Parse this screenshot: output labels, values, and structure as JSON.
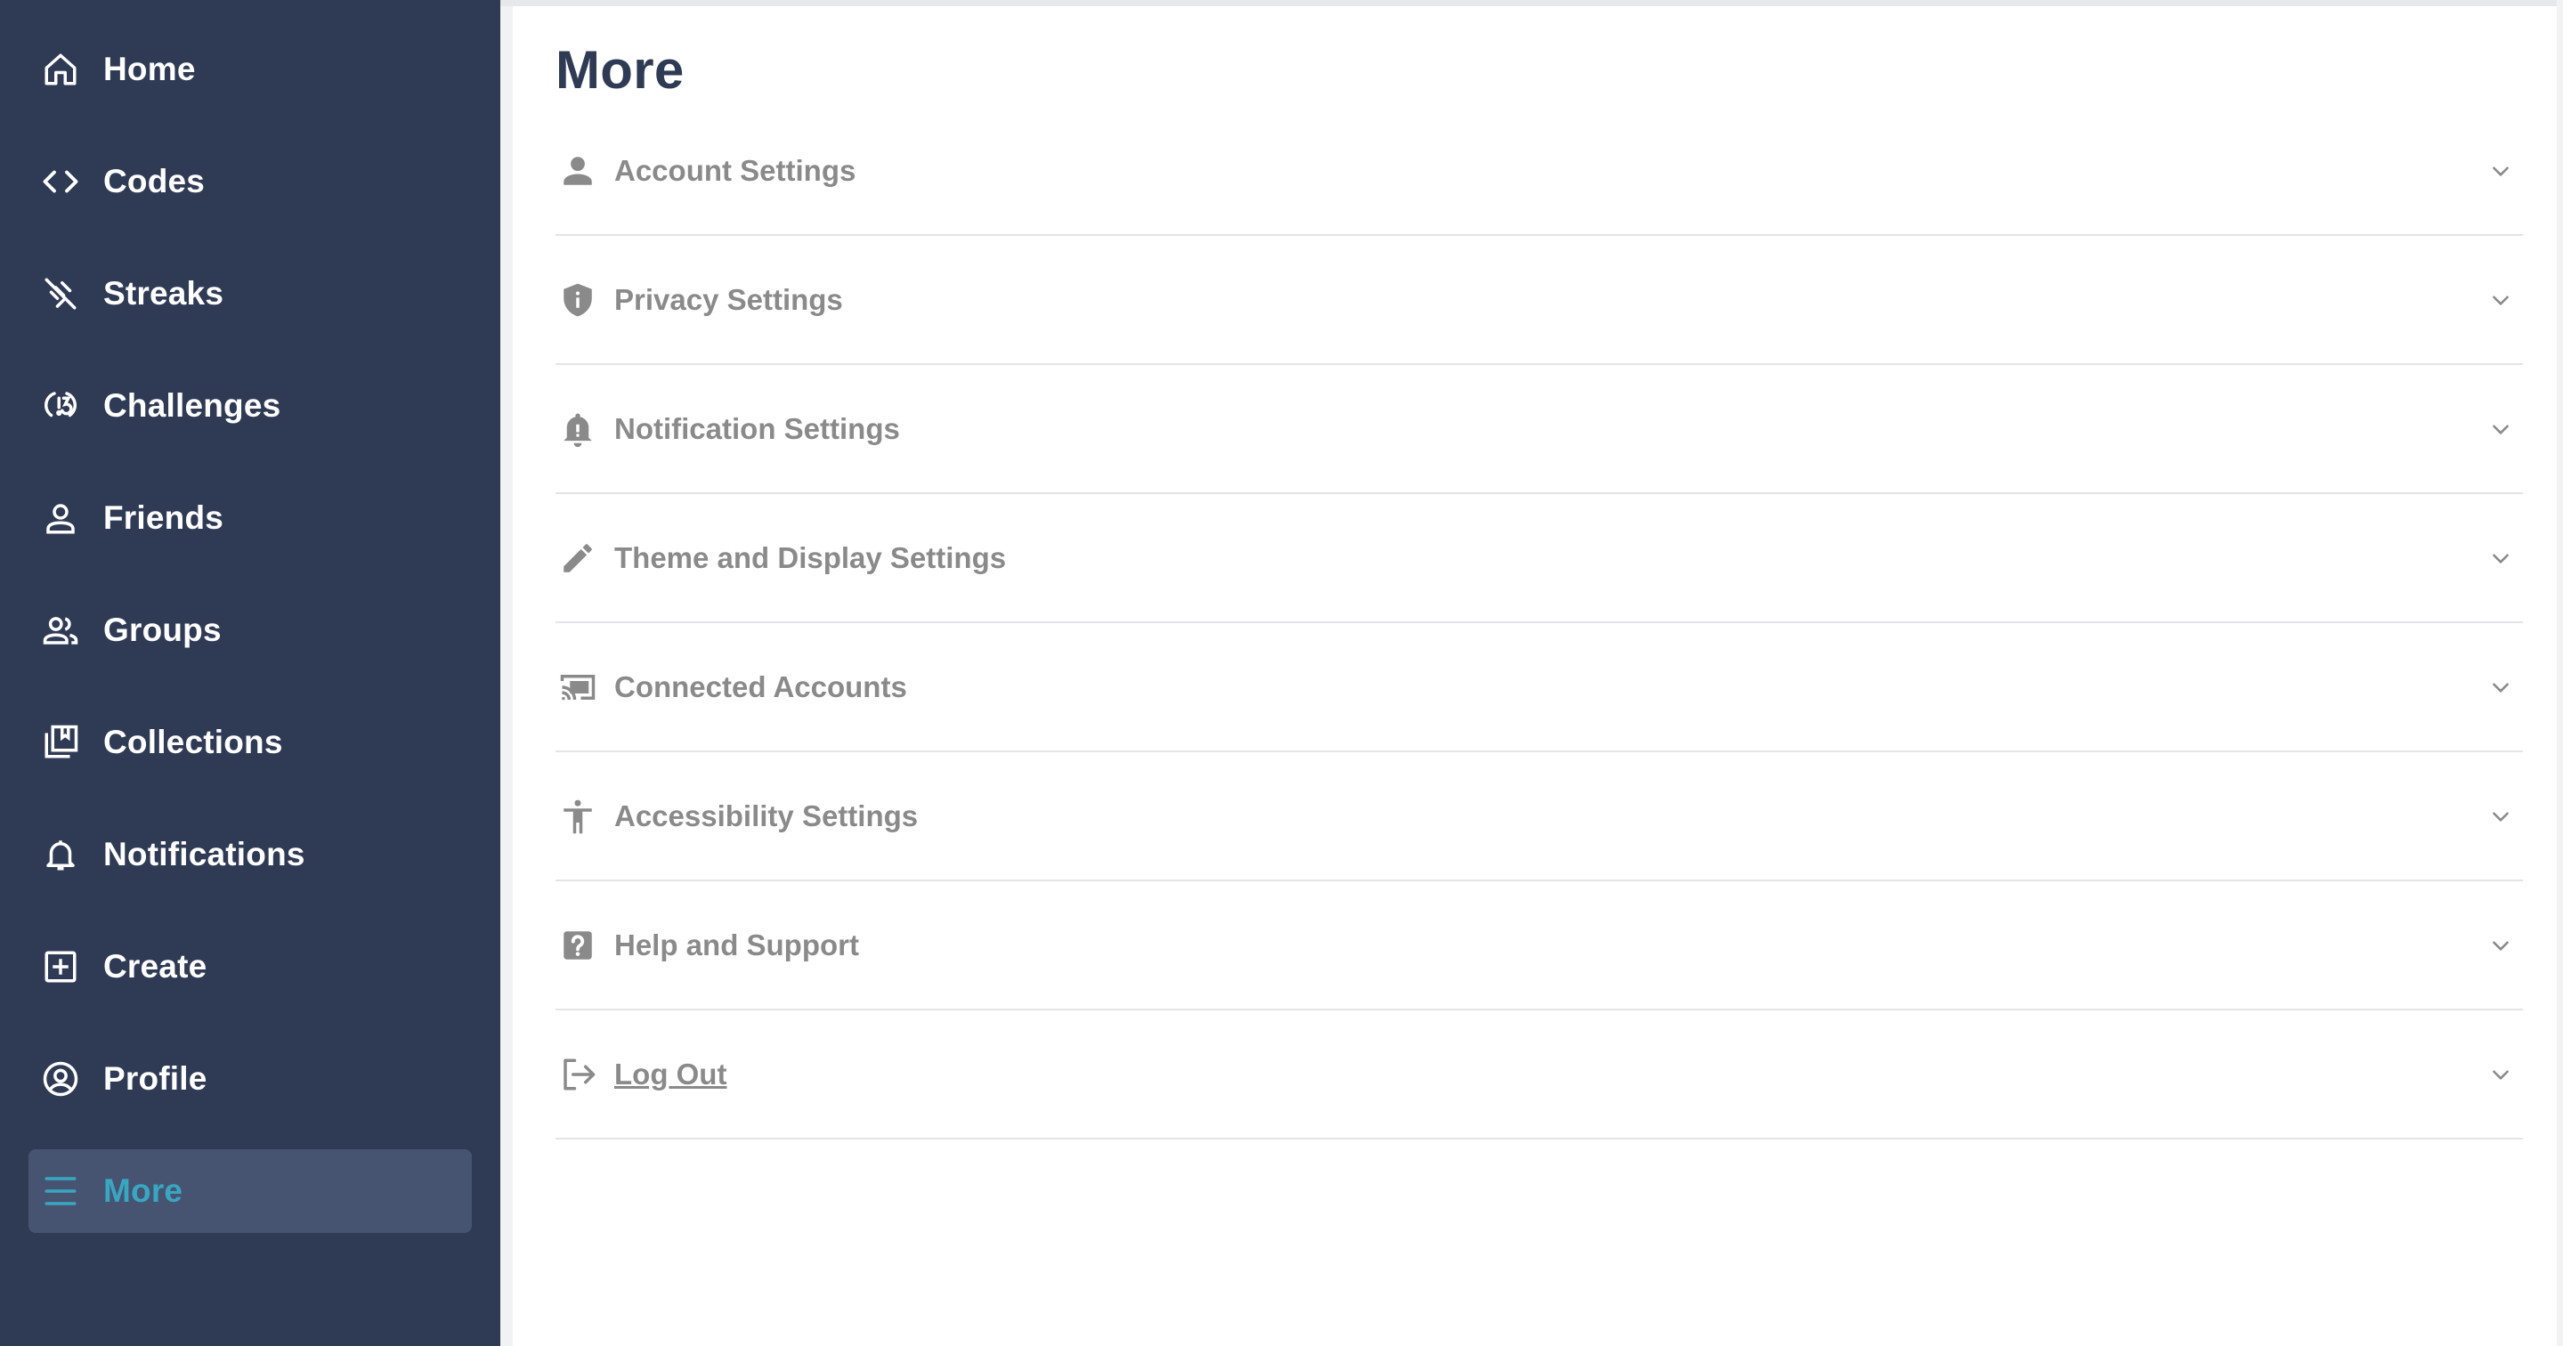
{
  "sidebar": {
    "items": [
      {
        "label": "Home",
        "icon": "home-icon"
      },
      {
        "label": "Codes",
        "icon": "code-icon"
      },
      {
        "label": "Streaks",
        "icon": "streak-icon"
      },
      {
        "label": "Challenges",
        "icon": "challenge-icon"
      },
      {
        "label": "Friends",
        "icon": "person-icon"
      },
      {
        "label": "Groups",
        "icon": "group-icon"
      },
      {
        "label": "Collections",
        "icon": "collections-icon"
      },
      {
        "label": "Notifications",
        "icon": "bell-icon"
      },
      {
        "label": "Create",
        "icon": "plus-square-icon"
      },
      {
        "label": "Profile",
        "icon": "profile-circle-icon"
      },
      {
        "label": "More",
        "icon": "menu-icon",
        "active": true
      }
    ]
  },
  "main": {
    "title": "More",
    "settings": [
      {
        "label": "Account Settings",
        "icon": "person-icon"
      },
      {
        "label": "Privacy Settings",
        "icon": "shield-icon"
      },
      {
        "label": "Notification Settings",
        "icon": "bell-alert-icon"
      },
      {
        "label": "Theme and Display Settings",
        "icon": "pencil-icon"
      },
      {
        "label": "Connected Accounts",
        "icon": "cast-icon"
      },
      {
        "label": "Accessibility Settings",
        "icon": "accessibility-icon"
      },
      {
        "label": "Help and Support",
        "icon": "help-icon"
      },
      {
        "label": "Log Out",
        "icon": "logout-icon"
      }
    ]
  },
  "colors": {
    "sidebar_bg": "#2f3a55",
    "sidebar_active_bg": "#475471",
    "active_text": "#39a6c2",
    "title_text": "#2f3a55",
    "row_text": "#8a8a8a"
  }
}
